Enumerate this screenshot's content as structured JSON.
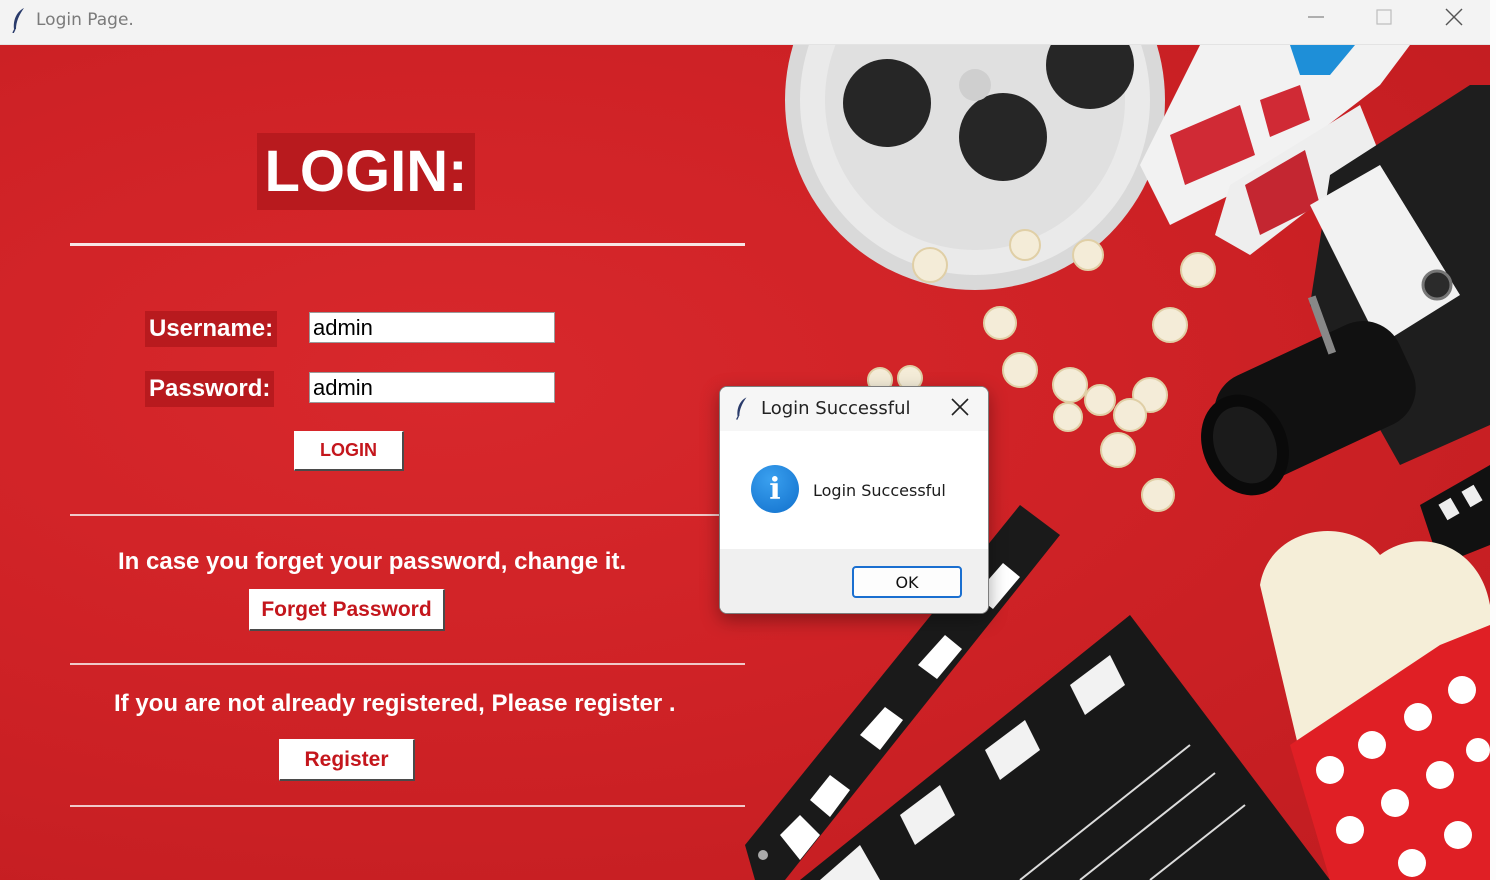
{
  "window": {
    "title": "Login Page.",
    "icon": "feather-icon",
    "controls": [
      "minimize-icon",
      "maximize-icon",
      "close-icon"
    ]
  },
  "login": {
    "heading": "LOGIN:",
    "username_label": "Username:",
    "username_value": "admin",
    "password_label": "Password:",
    "password_value": "admin",
    "login_button": "LOGIN"
  },
  "forgot": {
    "caption": "In case you forget your password, change it.",
    "button": "Forget Password"
  },
  "register": {
    "caption": "If you are not already registered, Please register .",
    "button": "Register"
  },
  "dialog": {
    "title": "Login Successful",
    "message": "Login Successful",
    "ok_button": "OK",
    "icon": "info-icon"
  },
  "colors": {
    "background_red": "#cf2226",
    "label_bg": "#b81a1e",
    "button_text": "#c4161c",
    "dialog_accent": "#1a6fd0"
  }
}
